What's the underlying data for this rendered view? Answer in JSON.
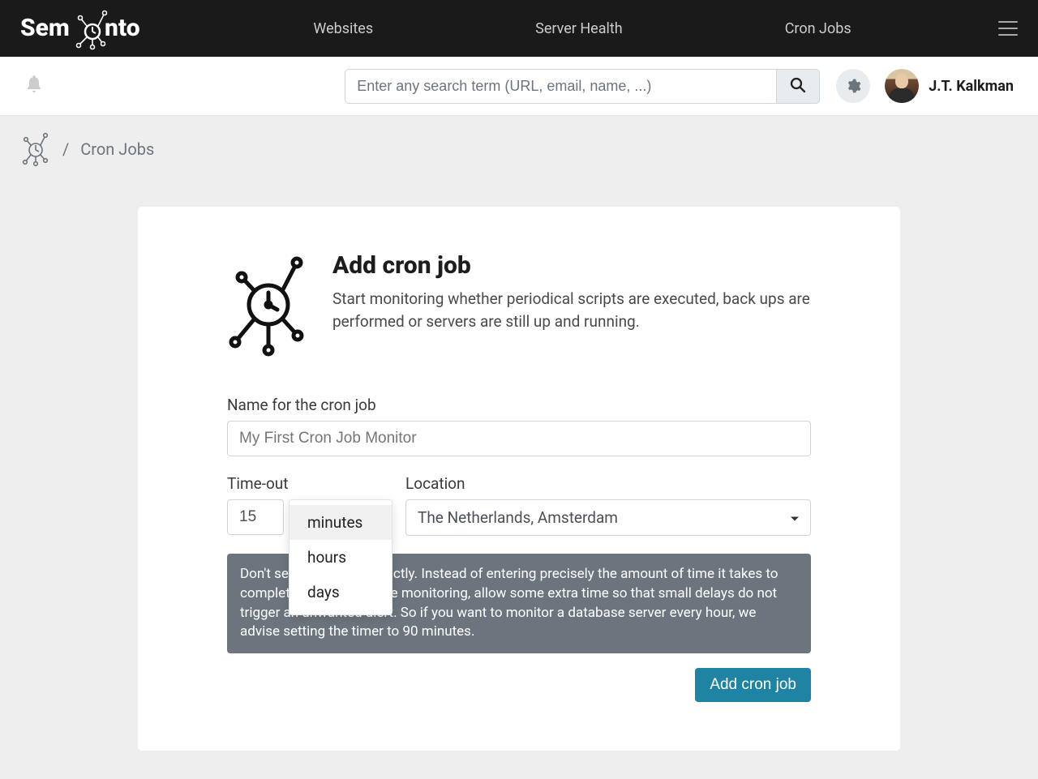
{
  "brand": "Semonto",
  "nav": {
    "websites": "Websites",
    "server_health": "Server Health",
    "cron_jobs": "Cron Jobs"
  },
  "search": {
    "placeholder": "Enter any search term (URL, email, name, ...)"
  },
  "user": {
    "name": "J.T. Kalkman"
  },
  "breadcrumb": {
    "sep": "/",
    "current": "Cron Jobs"
  },
  "page": {
    "title": "Add cron job",
    "description": "Start monitoring whether periodical scripts are executed, back ups are performed or servers are still up and running."
  },
  "form": {
    "name_label": "Name for the cron job",
    "name_placeholder": "My First Cron Job Monitor",
    "timeout_label": "Time-out",
    "timeout_value": "15",
    "timeout_unit_options": [
      "minutes",
      "hours",
      "days"
    ],
    "timeout_unit_selected": "minutes",
    "location_label": "Location",
    "location_value": "The Netherlands, Amsterdam",
    "hint": "Don't set the time too strictly. Instead of entering precisely the amount of time it takes to complete the task you are monitoring, allow some extra time so that small delays do not trigger an unwanted alert. So if you want to monitor a database server every hour, we advise setting the timer to 90 minutes.",
    "submit": "Add cron job"
  }
}
